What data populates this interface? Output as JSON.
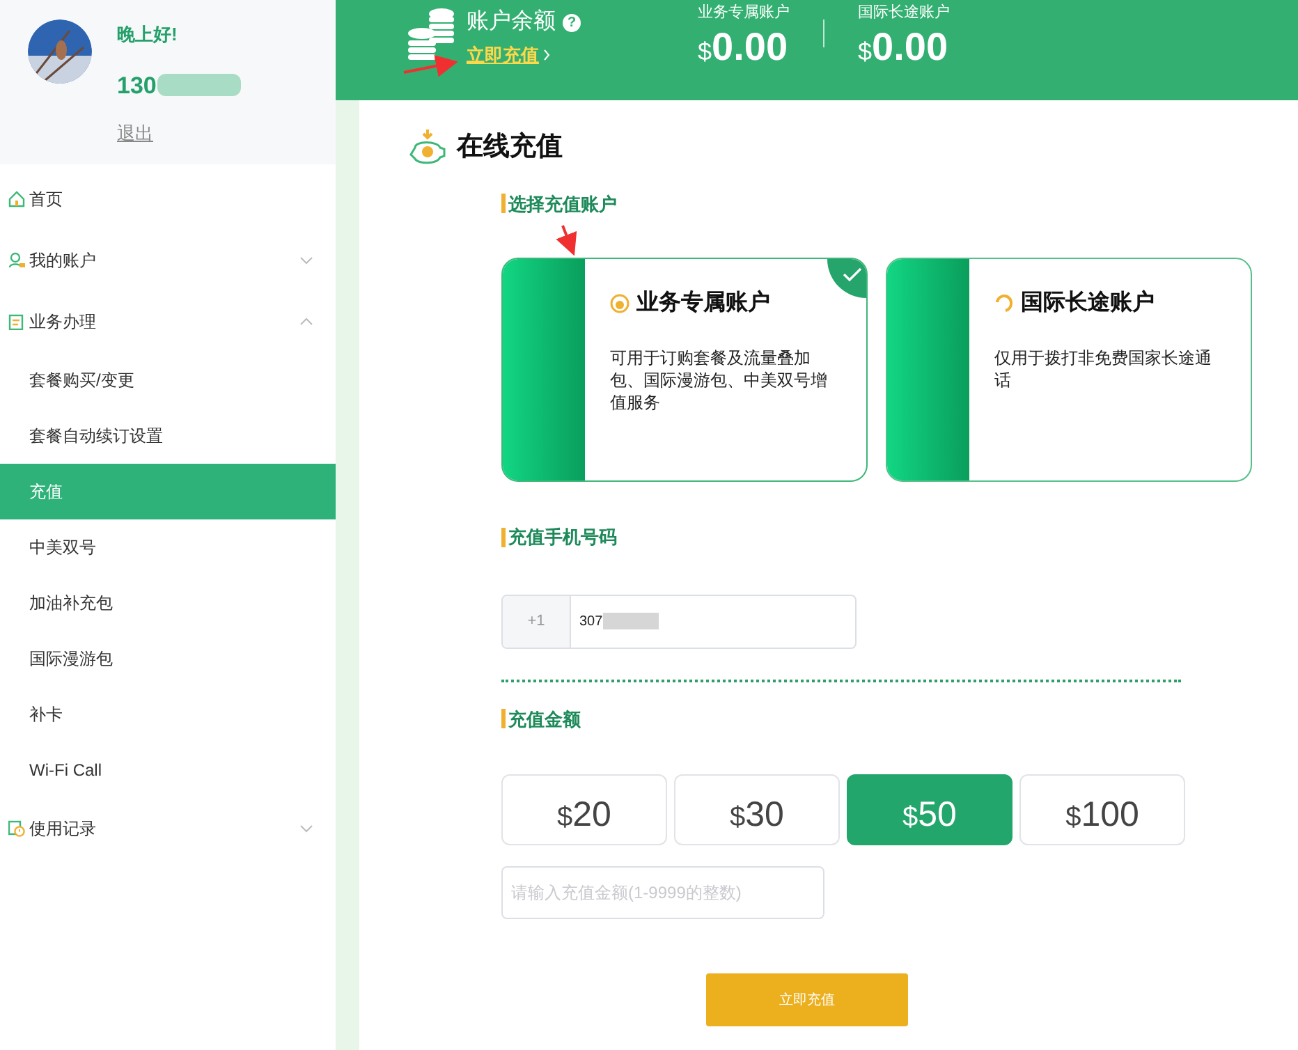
{
  "user": {
    "greeting": "晚上好!",
    "phone": "130",
    "logout": "退出"
  },
  "sidebar": {
    "items": [
      {
        "label": "首页",
        "kind": "link"
      },
      {
        "label": "我的账户",
        "kind": "group",
        "expanded": false
      },
      {
        "label": "业务办理",
        "kind": "group",
        "expanded": true,
        "children": [
          {
            "label": "套餐购买/变更",
            "selected": false
          },
          {
            "label": "套餐自动续订设置",
            "selected": false
          },
          {
            "label": "充值",
            "selected": true
          },
          {
            "label": "中美双号",
            "selected": false
          },
          {
            "label": "加油补充包",
            "selected": false
          },
          {
            "label": "国际漫游包",
            "selected": false
          },
          {
            "label": "补卡",
            "selected": false
          },
          {
            "label": "Wi-Fi Call",
            "selected": false
          }
        ]
      },
      {
        "label": "使用记录",
        "kind": "group",
        "expanded": false
      }
    ]
  },
  "header": {
    "balance_title": "账户余额",
    "help": "?",
    "recharge_link": "立即充值",
    "accounts": [
      {
        "label": "业务专属账户",
        "currency": "$",
        "amount": "0.00"
      },
      {
        "label": "国际长途账户",
        "currency": "$",
        "amount": "0.00"
      }
    ]
  },
  "page_title": "在线充值",
  "account_select": {
    "heading": "选择充值账户",
    "options": [
      {
        "title": "业务专属账户",
        "description": "可用于订购套餐及流量叠加包、国际漫游包、中美双号增值服务",
        "selected": true
      },
      {
        "title": "国际长途账户",
        "description": "仅用于拨打非免费国家长途通话",
        "selected": false
      }
    ]
  },
  "phone": {
    "heading": "充值手机号码",
    "prefix": "+1",
    "value": "307"
  },
  "amount": {
    "heading": "充值金额",
    "options": [
      {
        "currency": "$",
        "value": "20",
        "selected": false
      },
      {
        "currency": "$",
        "value": "30",
        "selected": false
      },
      {
        "currency": "$",
        "value": "50",
        "selected": true
      },
      {
        "currency": "$",
        "value": "100",
        "selected": false
      }
    ],
    "placeholder": "请输入充值金额(1-9999的整数)"
  },
  "submit": "立即充值"
}
